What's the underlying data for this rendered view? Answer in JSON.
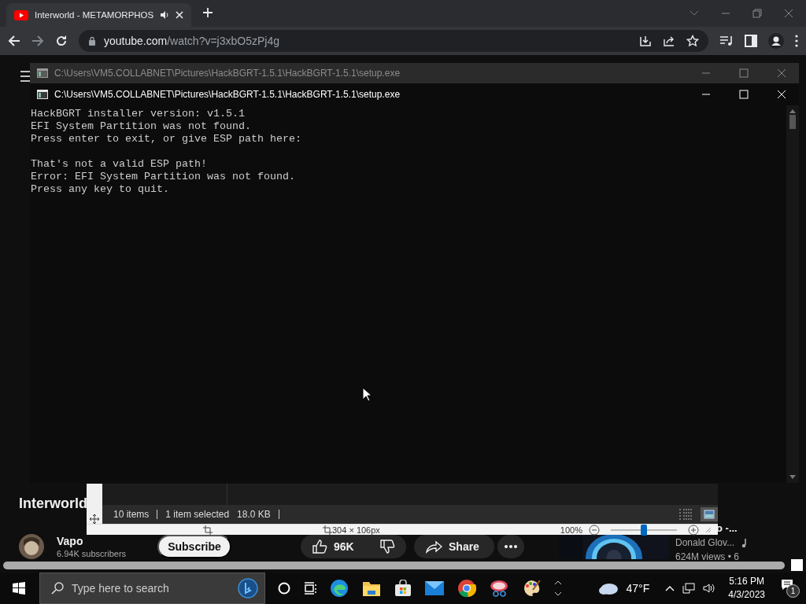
{
  "browser": {
    "tab_title": "Interworld - METAMORPHOS",
    "url_host": "youtube.com",
    "url_path": "/watch?v=j3xbO5zPj4g"
  },
  "console_back": {
    "title": "C:\\Users\\VM5.COLLABNET\\Pictures\\HackBGRT-1.5.1\\HackBGRT-1.5.1\\setup.exe",
    "active": false
  },
  "console": {
    "title": "C:\\Users\\VM5.COLLABNET\\Pictures\\HackBGRT-1.5.1\\HackBGRT-1.5.1\\setup.exe",
    "active": true,
    "blocks": [
      [
        "HackBGRT installer version: v1.5.1",
        "EFI System Partition was not found.",
        "Press enter to exit, or give ESP path here:"
      ],
      [
        "That's not a valid ESP path!",
        "Error: EFI System Partition was not found.",
        "Press any key to quit."
      ]
    ]
  },
  "explorer_status": {
    "items": "10 items",
    "selection": "1 item selected",
    "size": "18.0 KB"
  },
  "image_viewer": {
    "dimensions": "304 × 106px",
    "zoom": "100%",
    "level": 0.5
  },
  "video": {
    "title": "Interworld",
    "channel": "Vapo",
    "subscribers": "6.94K subscribers",
    "subscribe": "Subscribe",
    "likes": "96K",
    "share": "Share"
  },
  "suggestion": {
    "title": "o -...",
    "artist": "Donald Glov...",
    "views": "624M views • 6"
  },
  "taskbar": {
    "search_placeholder": "Type here to search",
    "weather": "47°F",
    "time": "5:16 PM",
    "date": "4/3/2023",
    "notifications": "1"
  }
}
